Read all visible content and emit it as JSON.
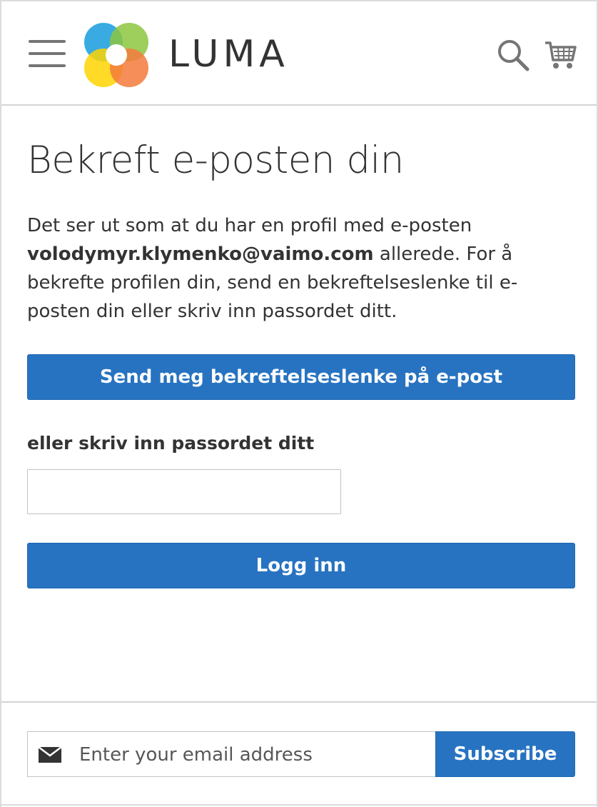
{
  "header": {
    "brand": "LUMA",
    "menu_icon": "hamburger-menu-icon",
    "search_icon": "search-icon",
    "cart_icon": "cart-icon",
    "logo_colors": [
      "#2ea7e0",
      "#8dc63f",
      "#ffd400",
      "#f47a3c"
    ]
  },
  "main": {
    "title": "Bekreft e-posten din",
    "intro_before": "Det ser ut som at du har en profil med e-posten ",
    "intro_email": "volodymyr.klymenko@vaimo.com",
    "intro_after": " allerede. For å bekrefte profilen din, send en bekreftelseslenke til e-posten din eller skriv inn passordet ditt.",
    "send_link_button": "Send meg bekreftelseslenke på e-post",
    "password_label": "eller skriv inn passordet ditt",
    "password_value": "",
    "login_button": "Logg inn"
  },
  "footer": {
    "newsletter": {
      "mail_icon": "envelope-icon",
      "placeholder": "Enter your email address",
      "subscribe_button": "Subscribe"
    }
  },
  "colors": {
    "primary_button": "#2773c1",
    "text": "#333333",
    "border": "#c2c2c2"
  }
}
